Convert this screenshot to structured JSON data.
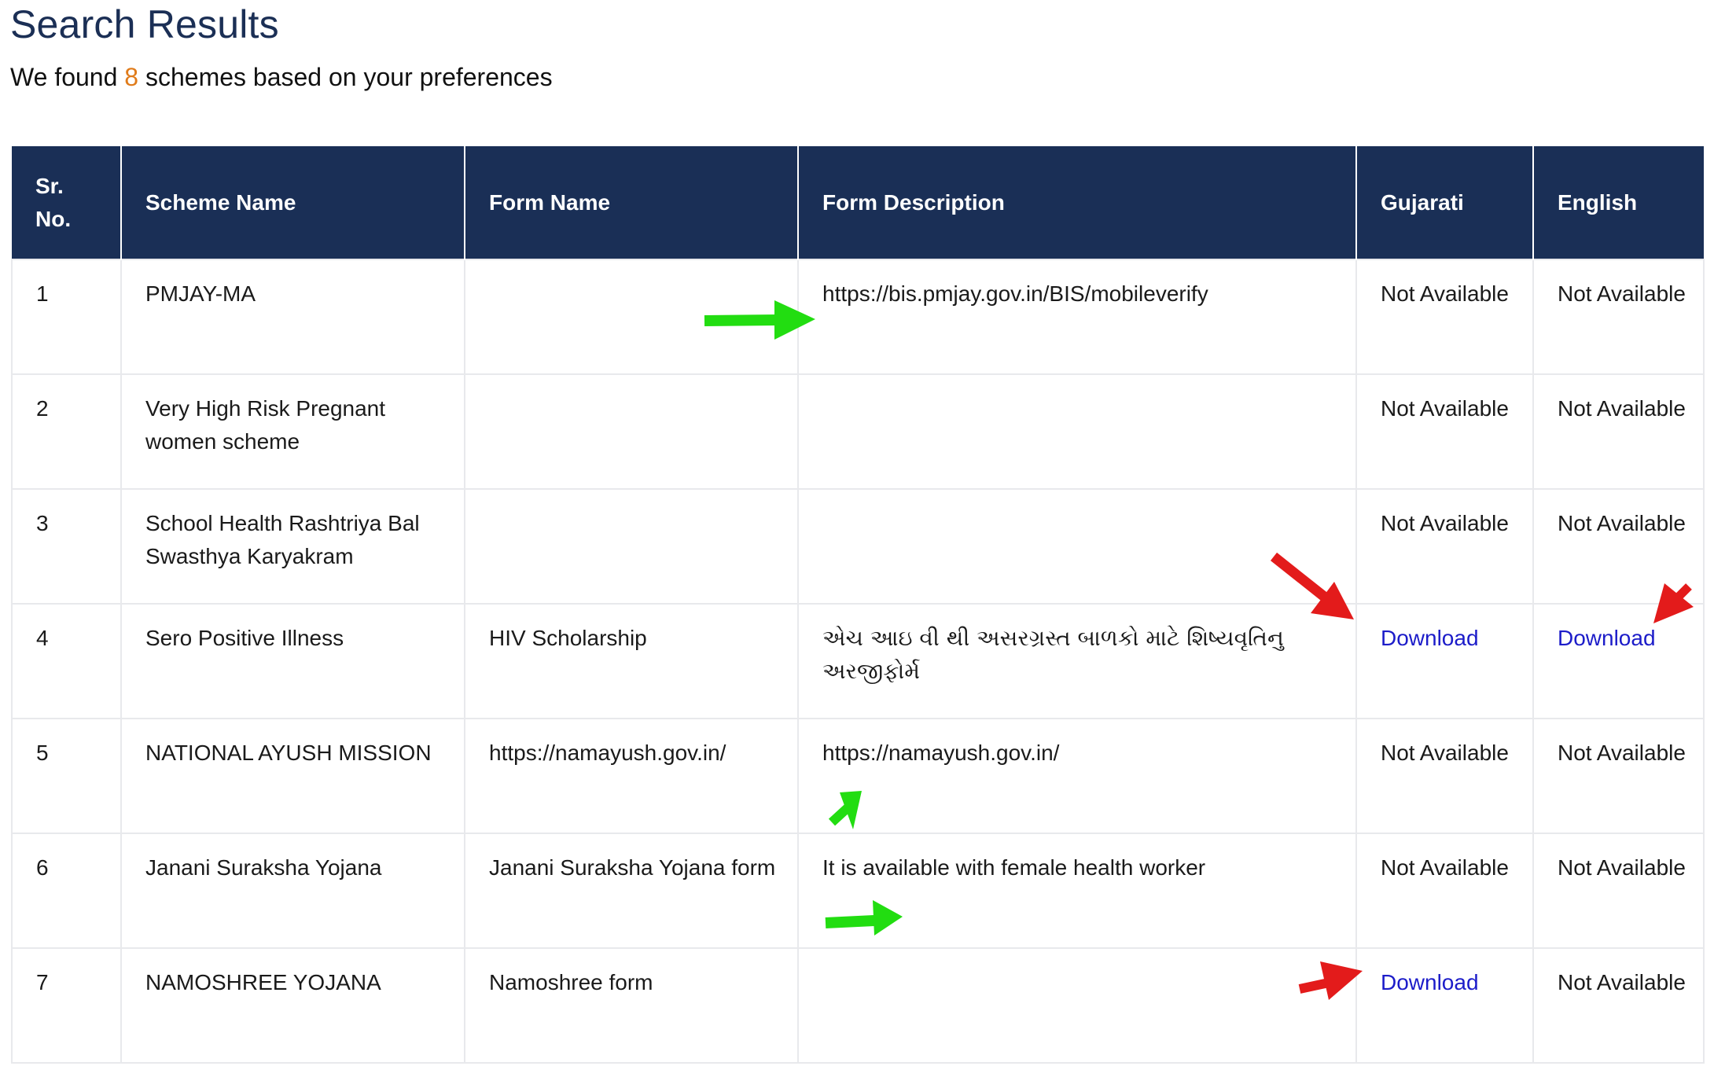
{
  "header": {
    "title": "Search Results",
    "subtitle_prefix": "We found ",
    "subtitle_count": "8",
    "subtitle_suffix": " schemes based on your preferences"
  },
  "colors": {
    "title": "#1b2f55",
    "count_accent": "#e07b1a",
    "table_header_bg": "#1a2f56",
    "link": "#1c1cc9",
    "annotation_green": "#22dd11",
    "annotation_red": "#e31b1b"
  },
  "table": {
    "columns": [
      "Sr. No.",
      "Scheme Name",
      "Form Name",
      "Form Description",
      "Gujarati",
      "English"
    ],
    "rows": [
      {
        "sr": "1",
        "scheme": "PMJAY-MA",
        "form": "",
        "description": "https://bis.pmjay.gov.in/BIS/mobileverify",
        "gujarati": "Not Available",
        "english": "Not Available"
      },
      {
        "sr": "2",
        "scheme": "Very High Risk Pregnant women scheme",
        "form": "",
        "description": "",
        "gujarati": "Not Available",
        "english": "Not Available"
      },
      {
        "sr": "3",
        "scheme": "School Health Rashtriya Bal Swasthya Karyakram",
        "form": "",
        "description": "",
        "gujarati": "Not Available",
        "english": "Not Available"
      },
      {
        "sr": "4",
        "scheme": "Sero Positive Illness",
        "form": "HIV Scholarship",
        "description": "એચ આઇ વી થી અસરગ્રસ્ત બાળકો માટે શિષ્યવૃતિનુ અરજીફોર્મ",
        "gujarati": "Download",
        "english": "Download"
      },
      {
        "sr": "5",
        "scheme": "NATIONAL AYUSH MISSION",
        "form": "https://namayush.gov.in/",
        "description": "https://namayush.gov.in/",
        "gujarati": "Not Available",
        "english": "Not Available"
      },
      {
        "sr": "6",
        "scheme": "Janani Suraksha Yojana",
        "form": "Janani Suraksha Yojana form",
        "description": "It is available with female health worker",
        "gujarati": "Not Available",
        "english": "Not Available"
      },
      {
        "sr": "7",
        "scheme": "NAMOSHREE YOJANA",
        "form": "Namoshree form",
        "description": "",
        "gujarati": "Download",
        "english": "Not Available"
      }
    ]
  },
  "annotations": [
    {
      "type": "arrow",
      "color": "green",
      "points_to": "row 1 form description"
    },
    {
      "type": "arrow",
      "color": "green",
      "points_to": "row 5 form description"
    },
    {
      "type": "arrow",
      "color": "green",
      "points_to": "row 6 form description"
    },
    {
      "type": "arrow",
      "color": "red",
      "points_to": "row 4 gujarati download"
    },
    {
      "type": "arrow",
      "color": "red",
      "points_to": "row 4 english download"
    },
    {
      "type": "arrow",
      "color": "red",
      "points_to": "row 7 gujarati download"
    }
  ]
}
